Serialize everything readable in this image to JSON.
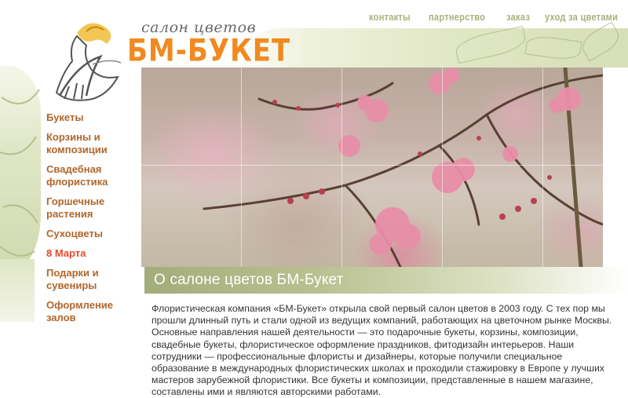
{
  "brand": {
    "subtitle": "салон цветов",
    "name": "БМ-БУКЕТ",
    "accent_color": "#f08a20",
    "logo_icon": "flower-woman-logo-icon"
  },
  "topnav": {
    "items": [
      {
        "label": "контакты"
      },
      {
        "label": "партнерство"
      },
      {
        "label": "заказ"
      },
      {
        "label": "уход за цветами"
      }
    ]
  },
  "sidebar": {
    "items": [
      {
        "label": "Букеты"
      },
      {
        "label": "Корзины и композиции"
      },
      {
        "label": "Свадебная флористика"
      },
      {
        "label": "Горшечные растения"
      },
      {
        "label": "Сухоцветы"
      },
      {
        "label": "8 Марта"
      },
      {
        "label": "Подарки и сувениры"
      },
      {
        "label": "Оформление залов"
      }
    ],
    "link_color": "#b0662b",
    "highlight_color": "#e24a2b"
  },
  "main": {
    "hero_image": "cherry-blossom-photo",
    "section_title": "О салоне цветов БМ-Букет",
    "body_text": "Флористическая компания «БМ-Букет» открыла свой первый салон цветов в 2003 году. С тех пор мы прошли длинный путь и стали одной из ведущих компаний, работающих на цветочном рынке Москвы. Основные направления нашей деятельности — это подарочные букеты, корзины, композиции, свадебные букеты, флористическое оформление праздников, фитодизайн интерьеров. Наши сотрудники — профессиональные флористы и дизайнеры, которые получили специальное образование в международных флористических школах и проходили стажировку в Европе у лучших мастеров зарубежной флористики. Все букеты и композиции, представленные в нашем магазине, составлены ими и являются авторскими работами."
  }
}
